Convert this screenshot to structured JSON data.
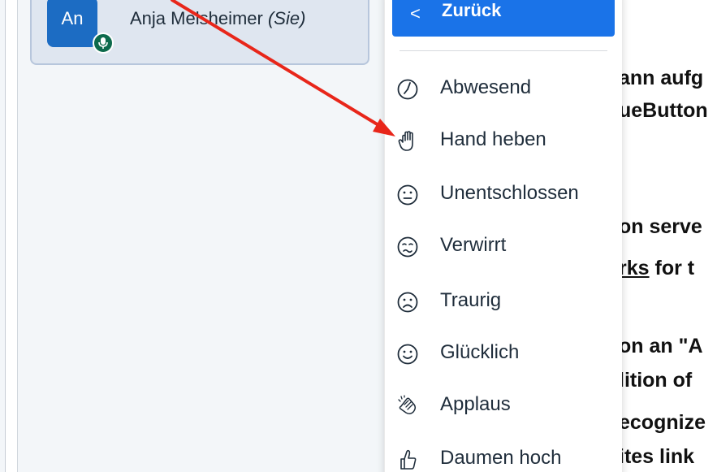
{
  "user": {
    "avatar_initials": "An",
    "name": "Anja Melsheimer",
    "self_tag": "(Sie)"
  },
  "menu": {
    "back_label": "Zurück",
    "items": [
      {
        "label": "Abwesend",
        "icon": "clock-icon"
      },
      {
        "label": "Hand heben",
        "icon": "raised-hand-icon"
      },
      {
        "label": "Unentschlossen",
        "icon": "neutral-face-icon"
      },
      {
        "label": "Verwirrt",
        "icon": "confused-face-icon"
      },
      {
        "label": "Traurig",
        "icon": "sad-face-icon"
      },
      {
        "label": "Glücklich",
        "icon": "happy-face-icon"
      },
      {
        "label": "Applaus",
        "icon": "applause-icon"
      },
      {
        "label": "Daumen hoch",
        "icon": "thumbs-up-icon"
      }
    ]
  },
  "background_text": {
    "line1": "ann aufg",
    "line2": "ueButton",
    "line3": "on serve",
    "line4a": "rks",
    "line4b": " for t",
    "line5": " on an \"A",
    "line6": "lition of",
    "line7": "ecognize",
    "line8": "ites link"
  },
  "colors": {
    "accent_blue": "#1a73e8",
    "avatar_blue": "#1c6cc3",
    "mic_green": "#0d6a4c",
    "arrow_red": "#e8261a"
  }
}
